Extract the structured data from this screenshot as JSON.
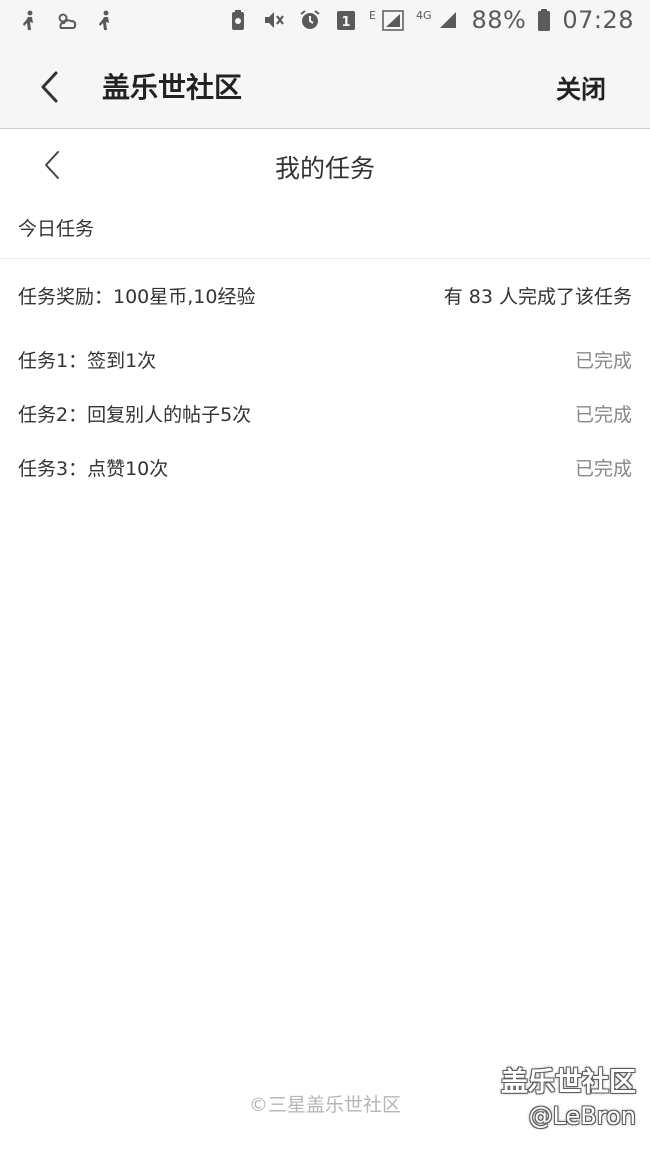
{
  "status_bar": {
    "network_e": "E",
    "network_4g": "4G",
    "battery": "88%",
    "time": "07:28",
    "notification_count": "1",
    "icons": [
      "person-walk-icon",
      "weather-icon",
      "person-walk-icon",
      "recycle-battery-icon",
      "mute-icon",
      "alarm-icon",
      "calendar-icon",
      "signal-icon",
      "signal-icon",
      "battery-icon"
    ]
  },
  "app_header": {
    "title": "盖乐世社区",
    "close_label": "关闭",
    "back_icon": "chevron-left-icon"
  },
  "page_header": {
    "title": "我的任务",
    "back_icon": "chevron-left-icon"
  },
  "section": {
    "label": "今日任务"
  },
  "reward_row": {
    "reward": "任务奖励：100星币,10经验",
    "completed_count": "有 83 人完成了该任务"
  },
  "tasks": [
    {
      "label": "任务1：签到1次",
      "status": "已完成"
    },
    {
      "label": "任务2：回复别人的帖子5次",
      "status": "已完成"
    },
    {
      "label": "任务3：点赞10次",
      "status": "已完成"
    }
  ],
  "footer": {
    "copyright": "©三星盖乐世社区"
  },
  "watermark": {
    "line1": "盖乐世社区",
    "line2": "@LeBron"
  },
  "colors": {
    "header_bg": "#f6f6f6",
    "text": "#333333",
    "status_done": "#888888",
    "footer_text": "#b5b5b5"
  }
}
